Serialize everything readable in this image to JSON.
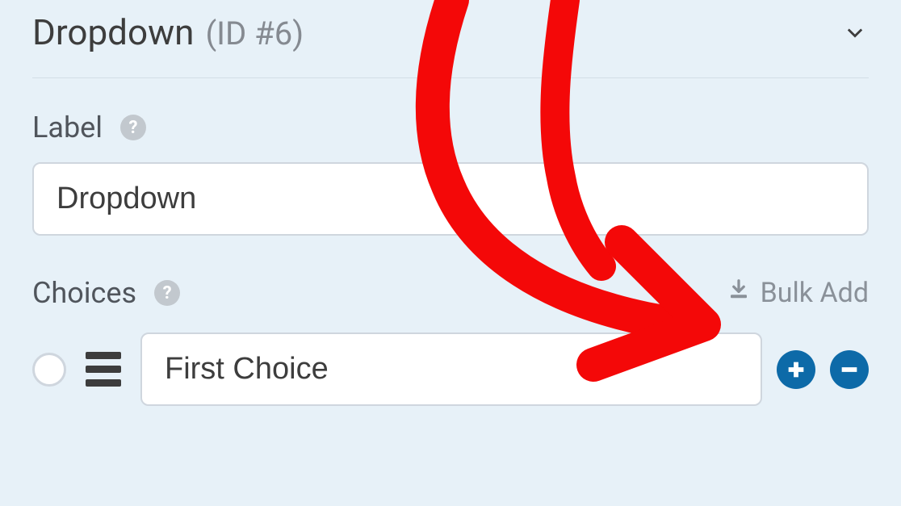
{
  "header": {
    "title": "Dropdown",
    "id_label": "(ID #6)"
  },
  "label_section": {
    "label": "Label",
    "value": "Dropdown"
  },
  "choices_section": {
    "label": "Choices",
    "bulk_add_label": "Bulk Add",
    "items": [
      {
        "value": "First Choice"
      }
    ]
  }
}
